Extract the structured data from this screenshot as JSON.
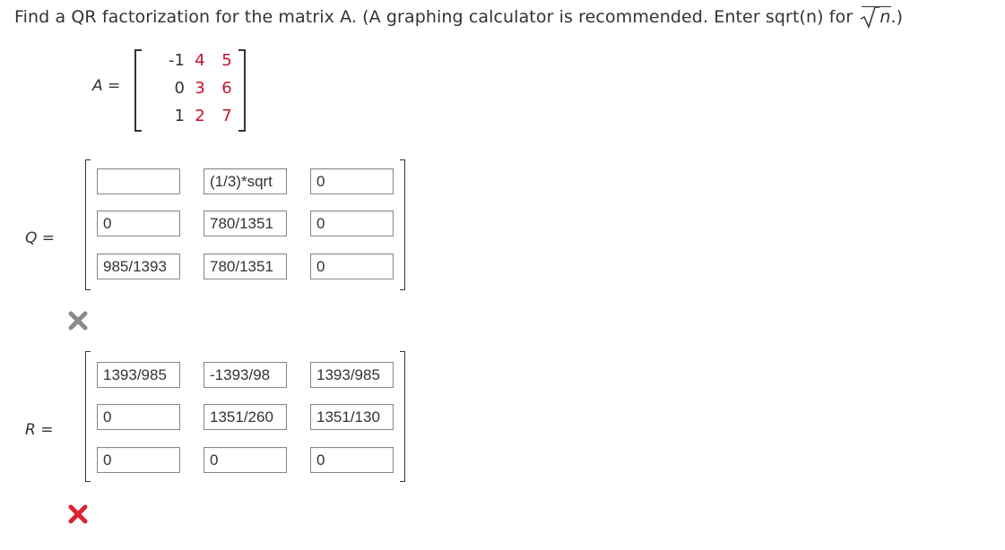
{
  "question": {
    "text": "Find a QR factorization for the matrix A. (A graphing calculator is recommended. Enter sqrt(n) for ",
    "sqrt_symbol": "n",
    "suffix": ".)"
  },
  "matrix_A": {
    "label": "A =",
    "rows": [
      [
        "-1",
        "4",
        "5"
      ],
      [
        "0",
        "3",
        "6"
      ],
      [
        "1",
        "2",
        "7"
      ]
    ]
  },
  "matrix_Q": {
    "label": "Q =",
    "cells": [
      [
        "",
        "(1/3)*sqrt",
        "0"
      ],
      [
        "0",
        "780/1351",
        "0"
      ],
      [
        "985/1393",
        "780/1351",
        "0"
      ]
    ],
    "result": "incorrect"
  },
  "matrix_R": {
    "label": "R =",
    "cells": [
      [
        "1393/985",
        "-1393/98",
        "1393/985"
      ],
      [
        "0",
        "1351/260",
        "1351/130"
      ],
      [
        "0",
        "0",
        "0"
      ]
    ],
    "result": "incorrect"
  },
  "colors": {
    "text": "#333333",
    "matrix_entry": "#c8102e",
    "wrong_gray": "#888888",
    "wrong_red": "#d9232d"
  }
}
